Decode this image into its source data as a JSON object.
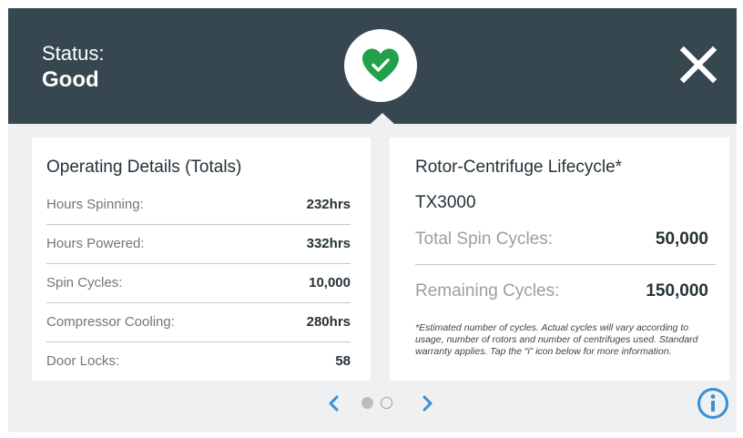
{
  "header": {
    "status_label": "Status:",
    "status_value": "Good",
    "status_icon": "heart-check-icon",
    "status_color": "#22a04b",
    "background": "#37474f"
  },
  "operating": {
    "title": "Operating Details (Totals)",
    "rows": [
      {
        "label": "Hours Spinning:",
        "value": "232hrs"
      },
      {
        "label": "Hours Powered:",
        "value": "332hrs"
      },
      {
        "label": "Spin Cycles:",
        "value": "10,000"
      },
      {
        "label": "Compressor Cooling:",
        "value": "280hrs"
      },
      {
        "label": "Door Locks:",
        "value": "58"
      }
    ]
  },
  "lifecycle": {
    "title": "Rotor-Centrifuge Lifecycle*",
    "model": "TX3000",
    "total_label": "Total Spin Cycles:",
    "total_value": "50,000",
    "remaining_label": "Remaining Cycles:",
    "remaining_value": "150,000",
    "footnote": "*Estimated number of cycles. Actual cycles will vary according to usage, number of rotors and number of centrifuges used. Standard warranty applies. Tap the “i” icon below for more information."
  },
  "pager": {
    "current_page": 1,
    "total_pages": 2,
    "accent": "#3a8fd6"
  }
}
